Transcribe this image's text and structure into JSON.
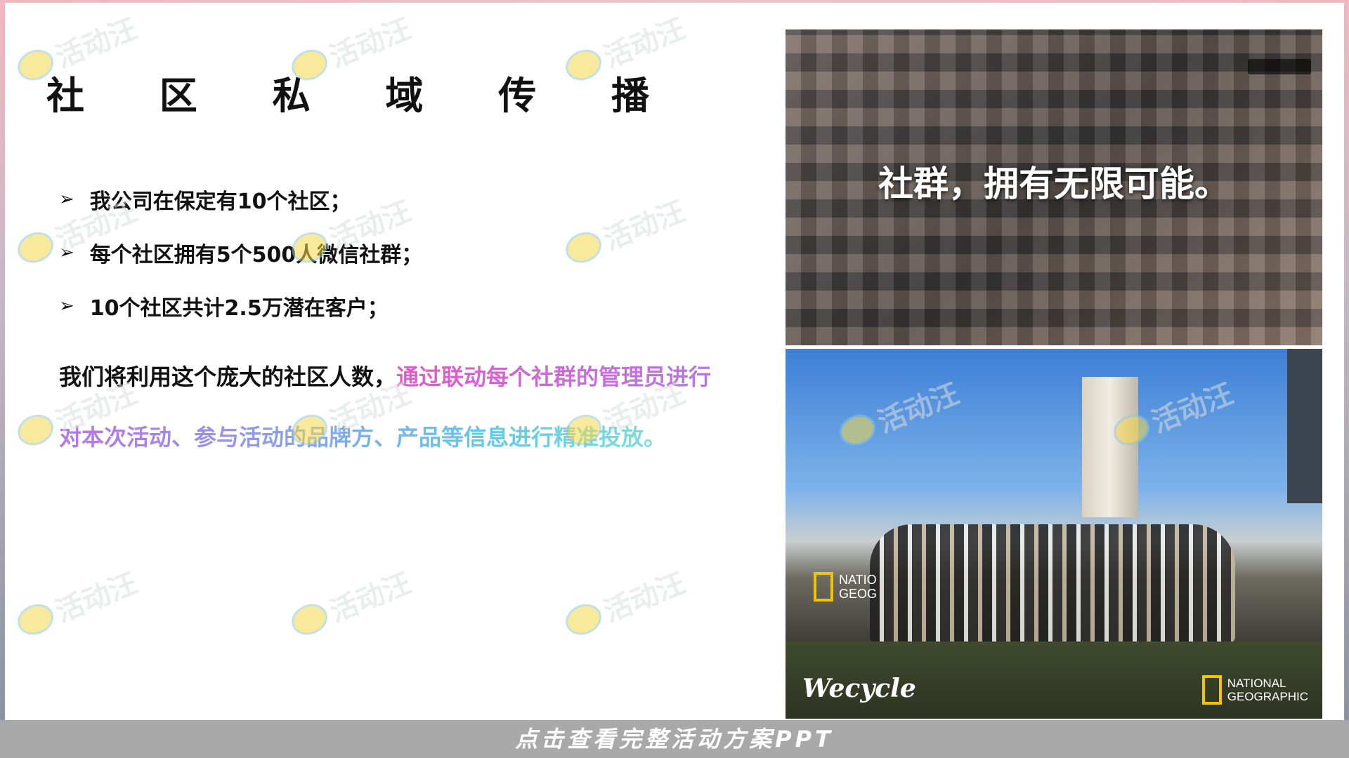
{
  "title": "社 区 私 域 传 播",
  "bullets": [
    "我公司在保定有10个社区；",
    "每个社区拥有5个500人微信社群；",
    "10个社区共计2.5万潜在客户；"
  ],
  "bullet_marker": "➢",
  "paragraph": {
    "plain": "我们将利用这个庞大的社区人数，",
    "highlight": "通过联动每个社群的管理员进行对本次活动、参与活动的品牌方、产品等信息进行精准投放。"
  },
  "photo_top": {
    "overlay_text": "社群，拥有无限可能。"
  },
  "photo_bottom": {
    "brand_left": "Wecycle",
    "brand_right_line1": "NATIONAL",
    "brand_right_line2": "GEOGRAPHIC",
    "sign_left_line1": "NATIO",
    "sign_left_line2": "GEOG"
  },
  "watermark": "活动汪",
  "bottom_bar": "点击查看完整活动方案PPT",
  "colors": {
    "highlight_gradient": [
      "#e05cc8",
      "#b07ce8",
      "#5fc9e8",
      "#7fe0d8"
    ],
    "bottom_bar_bg": "#a9a9a9",
    "frame": "#f2b7bf"
  }
}
